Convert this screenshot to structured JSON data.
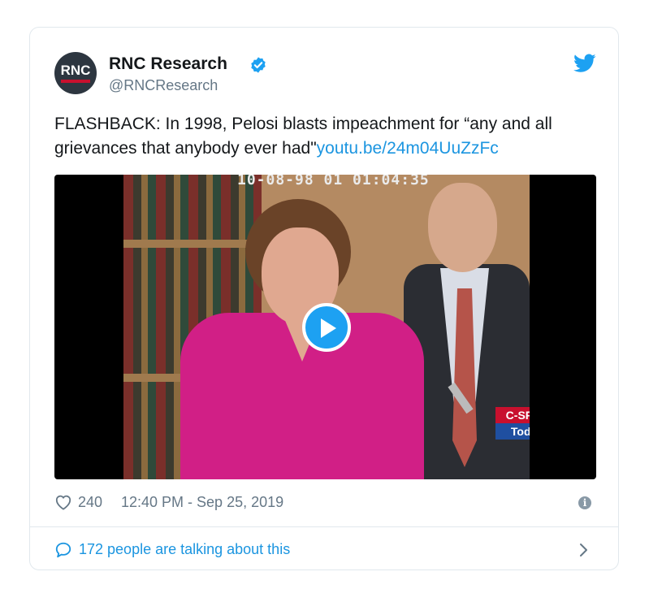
{
  "account": {
    "avatar_text": "RNC",
    "name": "RNC Research",
    "handle": "@RNCResearch"
  },
  "tweet": {
    "text": "FLASHBACK: In 1998, Pelosi blasts impeachment for “any and all grievances that anybody ever had\"",
    "link": "youtu.be/24m04UuZzFc"
  },
  "video": {
    "timestamp_overlay": "10-08-98  01  01:04:35",
    "badge_top": "C-SPAN",
    "badge_bottom": "Today"
  },
  "footer": {
    "likes": "240",
    "datetime": "12:40 PM - Sep 25, 2019",
    "talking": "172 people are talking about this"
  },
  "colors": {
    "link": "#1b95e0",
    "secondary_text": "#657786",
    "twitter_blue": "#1da1f2",
    "border": "#e1e8ed"
  },
  "icons": [
    "verified-icon",
    "twitter-bird-icon",
    "play-icon",
    "heart-icon",
    "info-icon",
    "speech-bubble-icon",
    "chevron-right-icon"
  ]
}
